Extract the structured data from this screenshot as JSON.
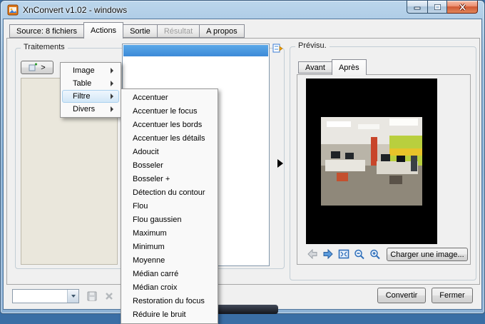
{
  "window": {
    "title": "XnConvert v1.02 - windows"
  },
  "colors": {
    "titlebar_glass": "#7ba7cf",
    "dialog_bg": "#f0f0f0",
    "selection_blue": "#3c8ad8",
    "menu_highlight_border": "#a9d0ee",
    "close_button_red": "#cf5833"
  },
  "tabs": [
    {
      "label": "Source: 8 fichiers",
      "state": "normal"
    },
    {
      "label": "Actions",
      "state": "active"
    },
    {
      "label": "Sortie",
      "state": "normal"
    },
    {
      "label": "Résultat",
      "state": "disabled"
    },
    {
      "label": "A propos",
      "state": "normal"
    }
  ],
  "treatments": {
    "group_label": "Traitements",
    "add_button_label": ">"
  },
  "menu": {
    "items": [
      {
        "label": "Image",
        "has_submenu": true
      },
      {
        "label": "Table",
        "has_submenu": true
      },
      {
        "label": "Filtre",
        "has_submenu": true,
        "highlighted": true
      },
      {
        "label": "Divers",
        "has_submenu": true
      }
    ]
  },
  "submenu": {
    "items": [
      "Accentuer",
      "Accentuer le focus",
      "Accentuer les bords",
      "Accentuer les détails",
      "Adoucit",
      "Bosseler",
      "Bosseler +",
      "Détection du contour",
      "Flou",
      "Flou gaussien",
      "Maximum",
      "Minimum",
      "Moyenne",
      "Médian carré",
      "Médian croix",
      "Restoration du focus",
      "Réduire le bruit"
    ]
  },
  "preview": {
    "group_label": "Prévisu.",
    "tabs": [
      {
        "label": "Avant",
        "state": "normal"
      },
      {
        "label": "Après",
        "state": "active"
      }
    ],
    "load_button_label": "Charger une image...",
    "toolbar_icons": [
      "back",
      "forward",
      "fit-to-window",
      "zoom-out",
      "zoom-in"
    ]
  },
  "footer": {
    "convert_label": "Convertir",
    "close_label": "Fermer"
  },
  "icons": {
    "minimize": "–",
    "maximize": "□",
    "close": "×",
    "submenu_arrow": "▸",
    "expand_arrow": "▶",
    "combo_chevron": "▾"
  }
}
